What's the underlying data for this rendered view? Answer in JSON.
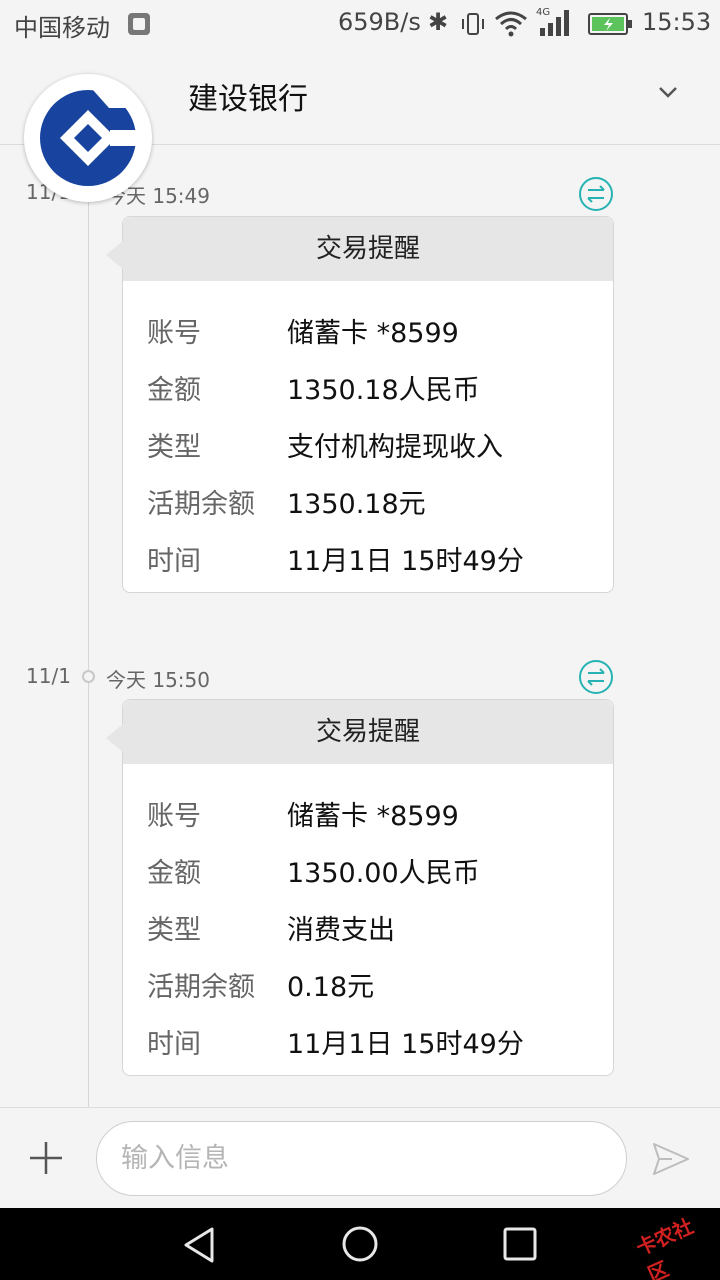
{
  "status_bar": {
    "carrier": "中国移动",
    "net_speed": "659B/s",
    "network_type": "4G",
    "time": "15:53"
  },
  "header": {
    "contact_name": "建设银行"
  },
  "messages": [
    {
      "date": "11/1",
      "time": "今天 15:49",
      "card_title": "交易提醒",
      "rows": [
        {
          "k": "账号",
          "v": "储蓄卡 *8599"
        },
        {
          "k": "金额",
          "v": "1350.18人民币"
        },
        {
          "k": "类型",
          "v": "支付机构提现收入"
        },
        {
          "k": "活期余额",
          "v": "1350.18元"
        },
        {
          "k": "时间",
          "v": "11月1日 15时49分"
        }
      ]
    },
    {
      "date": "11/1",
      "time": "今天 15:50",
      "card_title": "交易提醒",
      "rows": [
        {
          "k": "账号",
          "v": "储蓄卡 *8599"
        },
        {
          "k": "金额",
          "v": "1350.00人民币"
        },
        {
          "k": "类型",
          "v": "消费支出"
        },
        {
          "k": "活期余额",
          "v": "0.18元"
        },
        {
          "k": "时间",
          "v": "11月1日 15时49分"
        }
      ]
    }
  ],
  "input": {
    "placeholder": "输入信息"
  },
  "watermark": {
    "text": "卡农社区"
  },
  "colors": {
    "accent": "#27b3b3",
    "brand_blue": "#1844a0",
    "card_header": "#e6e6e6"
  },
  "icons": [
    "sim-icon",
    "bluetooth-icon",
    "vibrate-icon",
    "wifi-icon",
    "signal-icon",
    "battery-icon",
    "chevron-down-icon",
    "sync-icon",
    "plus-icon",
    "send-icon",
    "back-icon",
    "home-icon",
    "recent-apps-icon"
  ]
}
